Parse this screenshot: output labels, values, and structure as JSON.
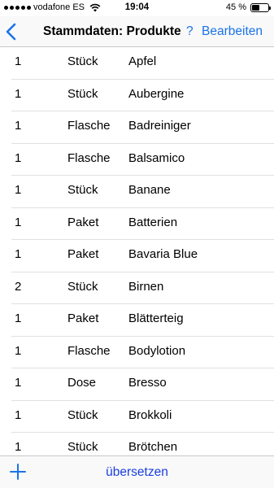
{
  "status_bar": {
    "carrier": "vodafone ES",
    "time": "19:04",
    "battery_text": "45 %",
    "battery_level": 0.45
  },
  "nav": {
    "title": "Stammdaten: Produkte",
    "help": "?",
    "edit": "Bearbeiten",
    "back_icon": "chevron-left-icon"
  },
  "products": [
    {
      "qty": "1",
      "unit": "Stück",
      "name": "Apfel"
    },
    {
      "qty": "1",
      "unit": "Stück",
      "name": "Aubergine"
    },
    {
      "qty": "1",
      "unit": "Flasche",
      "name": "Badreiniger"
    },
    {
      "qty": "1",
      "unit": "Flasche",
      "name": "Balsamico"
    },
    {
      "qty": "1",
      "unit": "Stück",
      "name": "Banane"
    },
    {
      "qty": "1",
      "unit": "Paket",
      "name": "Batterien"
    },
    {
      "qty": "1",
      "unit": "Paket",
      "name": "Bavaria Blue"
    },
    {
      "qty": "2",
      "unit": "Stück",
      "name": "Birnen"
    },
    {
      "qty": "1",
      "unit": "Paket",
      "name": "Blätterteig"
    },
    {
      "qty": "1",
      "unit": "Flasche",
      "name": "Bodylotion"
    },
    {
      "qty": "1",
      "unit": "Dose",
      "name": "Bresso"
    },
    {
      "qty": "1",
      "unit": "Stück",
      "name": "Brokkoli"
    },
    {
      "qty": "1",
      "unit": "Stück",
      "name": "Brötchen"
    }
  ],
  "toolbar": {
    "add_icon": "plus-icon",
    "translate": "übersetzen"
  },
  "colors": {
    "accent": "#1a73e8",
    "translate": "#1a3ee0",
    "separator": "#e0e0e4"
  }
}
